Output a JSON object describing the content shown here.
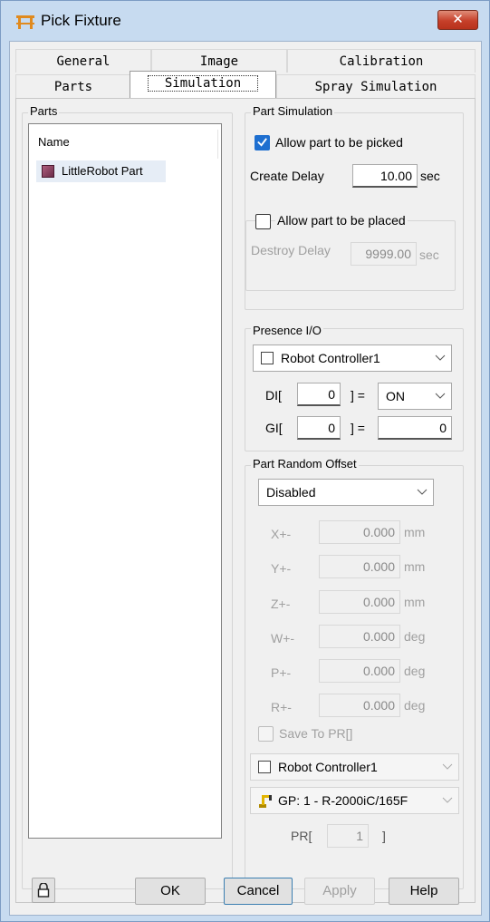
{
  "window": {
    "title": "Pick Fixture",
    "close_label": "✕"
  },
  "tabs": {
    "row1": [
      "General",
      "Image",
      "Calibration"
    ],
    "row2": [
      "Parts",
      "Simulation",
      "Spray Simulation"
    ],
    "active": "Simulation"
  },
  "parts": {
    "group_title": "Parts",
    "column_header": "Name",
    "items": [
      "LittleRobot Part"
    ]
  },
  "part_simulation": {
    "group_title": "Part Simulation",
    "allow_picked_label": "Allow part to be picked",
    "allow_picked_checked": true,
    "create_delay_label": "Create Delay",
    "create_delay_value": "10.00",
    "create_delay_unit": "sec",
    "allow_placed_label": "Allow part to be placed",
    "allow_placed_checked": false,
    "destroy_delay_label": "Destroy Delay",
    "destroy_delay_value": "9999.00",
    "destroy_delay_unit": "sec"
  },
  "presence_io": {
    "group_title": "Presence I/O",
    "controller": "Robot Controller1",
    "di_label": "DI[",
    "di_index": "0",
    "di_close": "] =",
    "di_value": "ON",
    "gi_label": "GI[",
    "gi_index": "0",
    "gi_close": "] =",
    "gi_value": "0"
  },
  "random_offset": {
    "group_title": "Part Random Offset",
    "mode": "Disabled",
    "rows": [
      {
        "label": "X+-",
        "value": "0.000",
        "unit": "mm"
      },
      {
        "label": "Y+-",
        "value": "0.000",
        "unit": "mm"
      },
      {
        "label": "Z+-",
        "value": "0.000",
        "unit": "mm"
      },
      {
        "label": "W+-",
        "value": "0.000",
        "unit": "deg"
      },
      {
        "label": "P+-",
        "value": "0.000",
        "unit": "deg"
      },
      {
        "label": "R+-",
        "value": "0.000",
        "unit": "deg"
      }
    ],
    "save_to_pr_label": "Save To PR[]",
    "controller": "Robot Controller1",
    "group": "GP: 1 - R-2000iC/165F",
    "pr_label": "PR[",
    "pr_value": "1",
    "pr_close": "]"
  },
  "buttons": {
    "ok": "OK",
    "cancel": "Cancel",
    "apply": "Apply",
    "help": "Help"
  }
}
